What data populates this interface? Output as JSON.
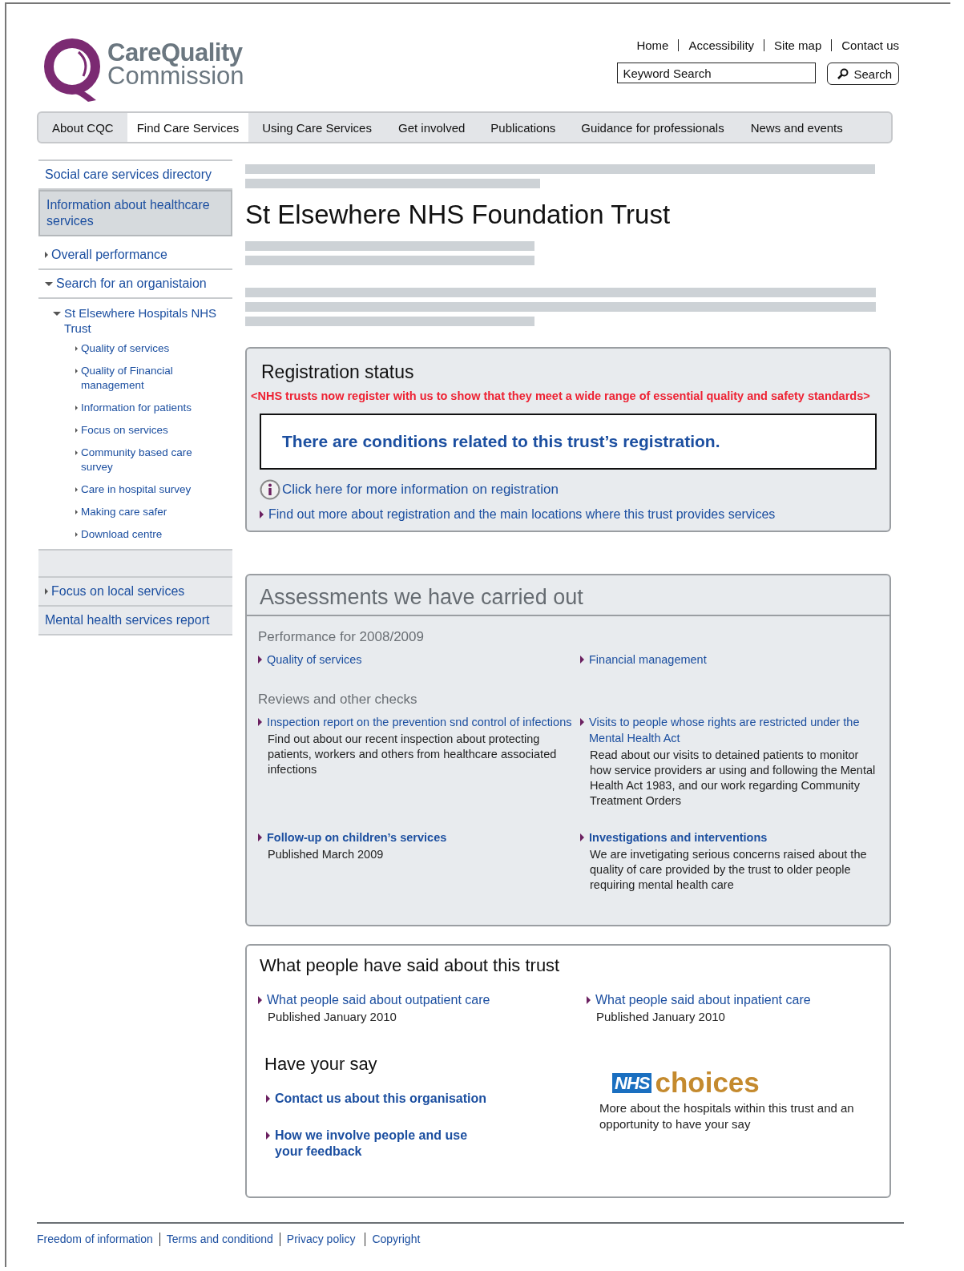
{
  "logo": {
    "line_1": "CareQuality",
    "line_2": "Commission"
  },
  "top_links": [
    "Home",
    "Accessibility",
    "Site map",
    "Contact us"
  ],
  "search": {
    "placeholder": "Keyword Search",
    "button": "Search"
  },
  "nav_tabs": [
    {
      "label": "About CQC",
      "selected": false
    },
    {
      "label": "Find Care Services",
      "selected": true
    },
    {
      "label": "Using Care Services",
      "selected": false
    },
    {
      "label": "Get involved",
      "selected": false
    },
    {
      "label": "Publications",
      "selected": false
    },
    {
      "label": "Guidance for professionals",
      "selected": false
    },
    {
      "label": "News and events",
      "selected": false
    }
  ],
  "sidebar": {
    "items": [
      {
        "label": "Social care services directory",
        "kind": "plain",
        "selected": false
      },
      {
        "label": "Information about healthcare services",
        "kind": "plain",
        "selected": true
      },
      {
        "label": "Overall performance",
        "kind": "plain",
        "selected": false,
        "expanded": false
      },
      {
        "label": "Search for an organistaion",
        "kind": "plain",
        "selected": false,
        "expanded": true,
        "children": [
          {
            "label": "St Elsewhere Hospitals NHS Trust",
            "expanded": true,
            "children": [
              {
                "label": "Quality of services",
                "expanded": false
              },
              {
                "label": "Quality of Financial management",
                "expanded": false
              },
              {
                "label": "Information for patients",
                "expanded": false
              },
              {
                "label": "Focus on services",
                "expanded": false
              },
              {
                "label": "Community based care survey",
                "expanded": false
              },
              {
                "label": "Care in hospital survey",
                "expanded": false
              },
              {
                "label": "Making care safer",
                "expanded": false
              },
              {
                "label": "Download centre",
                "expanded": false
              }
            ]
          }
        ]
      },
      {
        "kind": "spacer"
      },
      {
        "label": "Focus on local services",
        "kind": "shaded",
        "selected": false,
        "expanded": false
      },
      {
        "label": "Mental health services report",
        "kind": "shaded",
        "selected": false
      }
    ]
  },
  "page_title": "St Elsewhere NHS Foundation Trust",
  "registration": {
    "title": "Registration status",
    "notice": "<NHS trusts now register with us to show that they meet a wide range of essential quality and safety standards>",
    "condition": "There are conditions related to this trust’s registration.",
    "info_link": "Click here for more information on registration",
    "more_link": "Find out more about registration and the main locations where this trust provides services"
  },
  "assessments": {
    "title": "Assessments we have carried out",
    "sections": [
      {
        "heading": "Performance for 2008/2009",
        "items": [
          {
            "title": "Quality of services",
            "bold": false
          },
          {
            "title": "Financial management",
            "bold": false
          }
        ]
      },
      {
        "heading": "Reviews and other checks",
        "items": [
          {
            "title": "Inspection report on the prevention snd control of infections",
            "bold": false,
            "description": "Find out about our recent inspection about protecting patients, workers and others from healthcare associated infections"
          },
          {
            "title": "Visits to people whose rights are restricted under the Mental Health Act",
            "bold": false,
            "description": "Read about our visits to detained patients to monitor how service providers ar using and following the Mental Health Act 1983, and our work regarding Community Treatment Orders"
          },
          {
            "title": "Follow-up on children’s services",
            "bold": true,
            "description": "Published March 2009"
          },
          {
            "title": "Investigations and interventions",
            "bold": true,
            "description": "We are invetigating serious concerns raised about the quality of care provided by the trust to older people requiring mental health care"
          }
        ]
      }
    ]
  },
  "feedback": {
    "title": "What people have said about this trust",
    "items": [
      {
        "title": "What people said about outpatient care",
        "published": "Published January 2010"
      },
      {
        "title": "What people said about inpatient care",
        "published": "Published January 2010"
      }
    ],
    "have_your_say": {
      "title": "Have your say",
      "links": [
        "Contact us about this organisation",
        "How we involve people and use your feedback"
      ]
    },
    "nhs_choices": {
      "logo_box": "NHS",
      "logo_word": "choices",
      "description": "More about the hospitals within this trust and an opportunity to have your say"
    }
  },
  "footer_links": [
    "Freedom of information",
    "Terms and conditiond",
    "Privacy policy",
    "Copyright"
  ]
}
